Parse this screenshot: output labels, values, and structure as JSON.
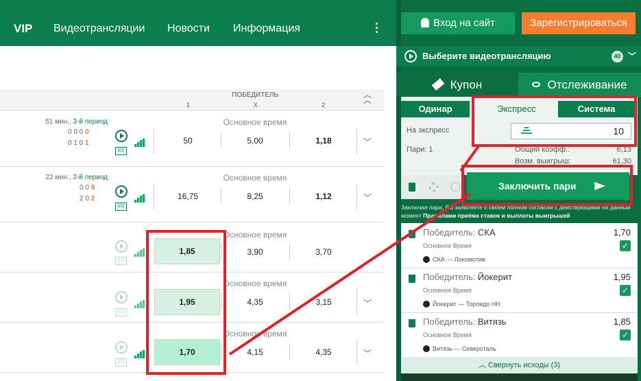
{
  "nav": {
    "vip": "VIP",
    "items": [
      "Видеотрансляции",
      "Новости",
      "Информация"
    ]
  },
  "auth": {
    "login": "Вход на сайт",
    "register": "Зарегистрироваться"
  },
  "video": {
    "label": "Выберите видеотрансляцию",
    "count": "40"
  },
  "coupon": {
    "tab_coupon": "Купон",
    "tab_track": "Отслеживание",
    "modes": [
      "Одинар",
      "Экспресс",
      "Система"
    ],
    "express_label": "На экспресс",
    "stake": "10",
    "bets_label": "Пари:",
    "bets_count": "1",
    "total_odds_label": "Общий коэфф.:",
    "total_odds": "6,13",
    "possible_win_label": "Возм. выигрыш:",
    "possible_win": "61,30",
    "place_button": "Заключить пари",
    "terms_prefix": "Заключая пари, Вы заявляете о своем полном согласии с действующими на данный момент",
    "terms_link": "Правилами приёма ставок и выплаты выигрышей",
    "selections": [
      {
        "market": "Победитель:",
        "pick": "СКА",
        "odd": "1,70",
        "type": "Основное Время",
        "match": "СКА — Локомотив"
      },
      {
        "market": "Победитель:",
        "pick": "Йокерит",
        "odd": "1,95",
        "type": "Основное Время",
        "match": "Йокерит — Торпедо НН"
      },
      {
        "market": "Победитель:",
        "pick": "Витязь",
        "odd": "1,85",
        "type": "Основное Время",
        "match": "Витязь — Северсталь"
      }
    ],
    "collapse": "Свернуть исходы (3)"
  },
  "table": {
    "header": {
      "market": "ПОБЕДИТЕЛЬ",
      "c1": "1",
      "cx": "X",
      "c2": "2"
    },
    "rows": [
      {
        "minute": "51 мин.,",
        "period": "3-й период",
        "score1": "0 0 0",
        "total1": "0",
        "score2": "0 1 0",
        "total2": "1",
        "time_label": "Основное время",
        "o1": "50",
        "ox": "5,00",
        "o2": "1,18"
      },
      {
        "minute": "22 мин.,",
        "period": "2-й период",
        "score1": "0 0",
        "total1": "0",
        "score2": "2 0",
        "total2": "2",
        "time_label": "Основное время",
        "o1": "16,75",
        "ox": "8,25",
        "o2": "1,12"
      },
      {
        "time_label": "Основное время",
        "o1": "1,85",
        "ox": "3,90",
        "o2": "3,70"
      },
      {
        "time_label": "Основное время",
        "o1": "1,95",
        "ox": "4,35",
        "o2": "3,15"
      },
      {
        "time_label": "Основное время",
        "o1": "1,70",
        "ox": "4,15",
        "o2": "4,35"
      }
    ]
  },
  "colors": {
    "brand": "#0b7d4f",
    "accent": "#f47d2f",
    "annotation": "#d9262c"
  }
}
